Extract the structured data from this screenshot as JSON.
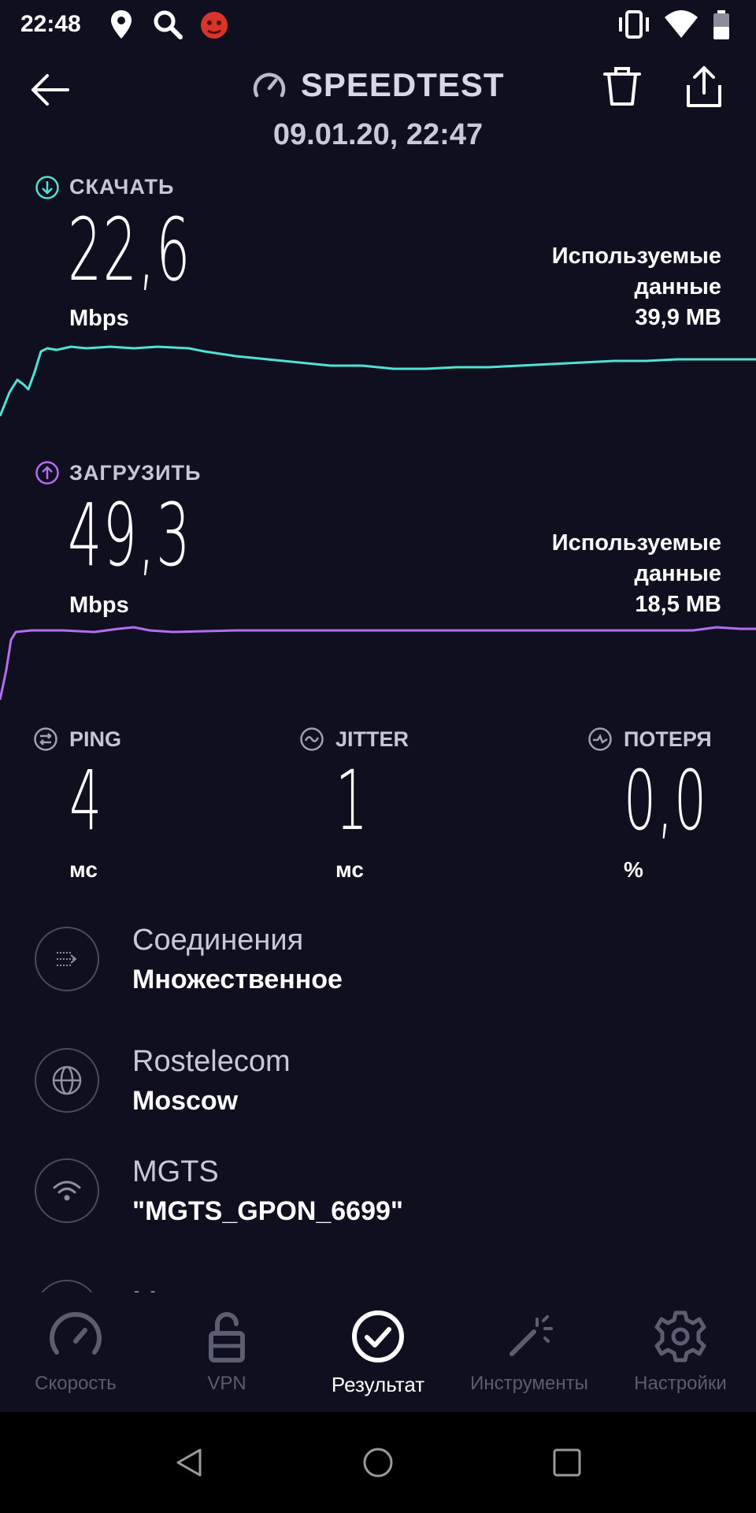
{
  "status_bar": {
    "time": "22:48"
  },
  "header": {
    "title": "SPEEDTEST",
    "datetime": "09.01.20, 22:47"
  },
  "download": {
    "label": "СКАЧАТЬ",
    "value": "22,6",
    "unit": "Mbps",
    "used_label_1": "Используемые",
    "used_label_2": "данные",
    "used_value": "39,9 MB",
    "color": "#4fe3d1"
  },
  "upload": {
    "label": "ЗАГРУЗИТЬ",
    "value": "49,3",
    "unit": "Mbps",
    "used_label_1": "Используемые",
    "used_label_2": "данные",
    "used_value": "18,5 MB",
    "color": "#b66cf0"
  },
  "metrics": {
    "ping": {
      "label": "PING",
      "value": "4",
      "unit": "мс"
    },
    "jitter": {
      "label": "JITTER",
      "value": "1",
      "unit": "мс"
    },
    "loss": {
      "label": "ПОТЕРЯ",
      "value": "0,0",
      "unit": "%"
    }
  },
  "info": [
    {
      "title": "Соединения",
      "subtitle": "Множественное",
      "icon": "connections-icon"
    },
    {
      "title": "Rostelecom",
      "subtitle": "Moscow",
      "icon": "globe-icon"
    },
    {
      "title": "MGTS",
      "subtitle": "\"MGTS_GPON_6699\"",
      "icon": "wifi-icon"
    },
    {
      "title": "Местоположение пользователя",
      "subtitle": "",
      "icon": "location-icon"
    }
  ],
  "nav": [
    {
      "label": "Скорость",
      "icon": "speedometer-icon"
    },
    {
      "label": "VPN",
      "icon": "unlock-icon"
    },
    {
      "label": "Результат",
      "icon": "check-circle-icon",
      "active": true
    },
    {
      "label": "Инструменты",
      "icon": "magic-wand-icon"
    },
    {
      "label": "Настройки",
      "icon": "gear-icon"
    }
  ],
  "colors": {
    "background": "#0f0f20",
    "download": "#4fe3d1",
    "upload": "#b66cf0"
  }
}
